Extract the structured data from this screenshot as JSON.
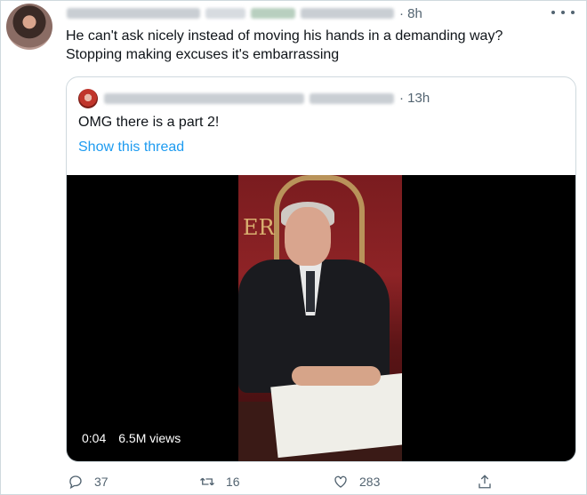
{
  "tweet": {
    "timestamp": "· 8h",
    "text_line1": "He can't ask nicely instead of moving his hands in a demanding way?",
    "text_line2": "Stopping making excuses it's embarrassing"
  },
  "quoted": {
    "timestamp": "· 13h",
    "text": "OMG there is a part 2!",
    "link": "Show this thread",
    "video": {
      "duration": "0:04",
      "views": "6.5M views",
      "frame_text": "ER"
    }
  },
  "actions": {
    "replies": "37",
    "retweets": "16",
    "likes": "283"
  },
  "icons": {
    "reply": "reply-icon",
    "retweet": "retweet-icon",
    "like": "heart-icon",
    "share": "share-icon",
    "more": "more-icon"
  },
  "colors": {
    "link": "#1d9bf0",
    "muted": "#536471",
    "text": "#0f1419",
    "border": "#cfd9de"
  }
}
